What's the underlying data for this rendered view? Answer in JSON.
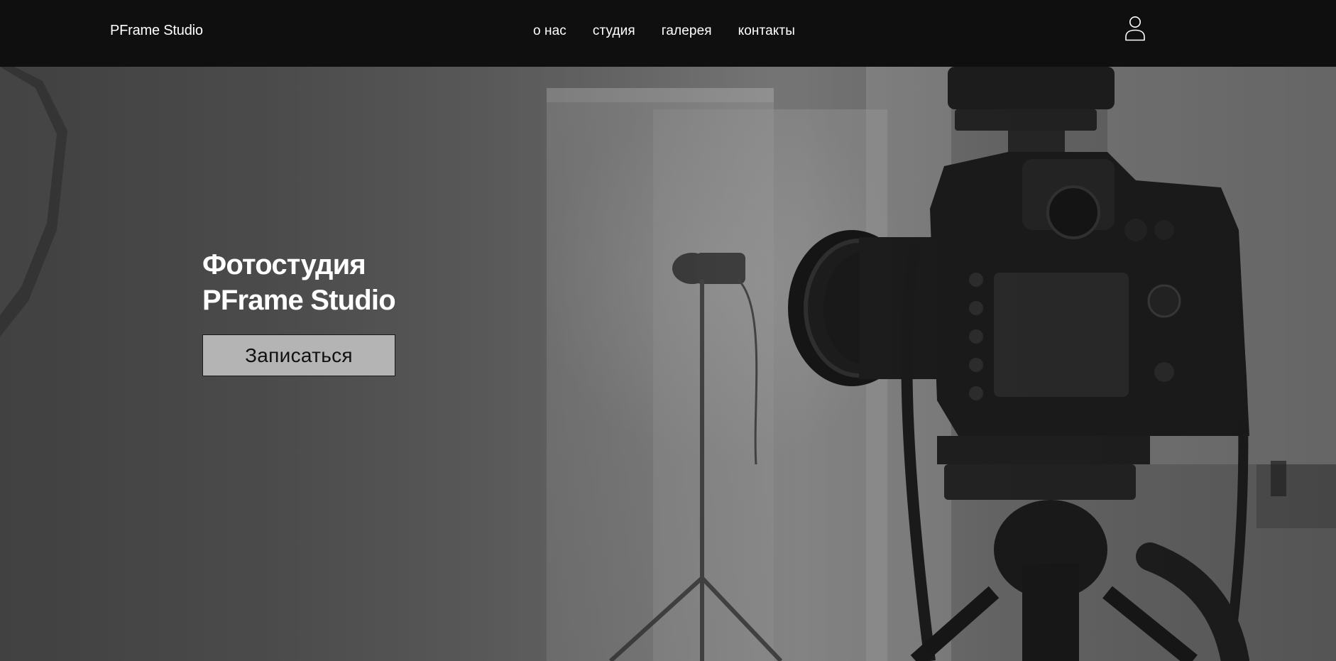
{
  "header": {
    "logo": "PFrame Studio",
    "nav": [
      {
        "label": "о нас"
      },
      {
        "label": "студия"
      },
      {
        "label": "галерея"
      },
      {
        "label": "контакты"
      }
    ],
    "user_icon": "user-icon"
  },
  "hero": {
    "title_line1": "Фотостудия",
    "title_line2": "PFrame Studio",
    "cta_label": "Записаться",
    "background_icon": "camera-photo"
  },
  "colors": {
    "header_bg": "#0f0f0f",
    "text": "#ffffff",
    "button_bg": "#b4b4b4",
    "button_border": "#1a1a1a"
  }
}
